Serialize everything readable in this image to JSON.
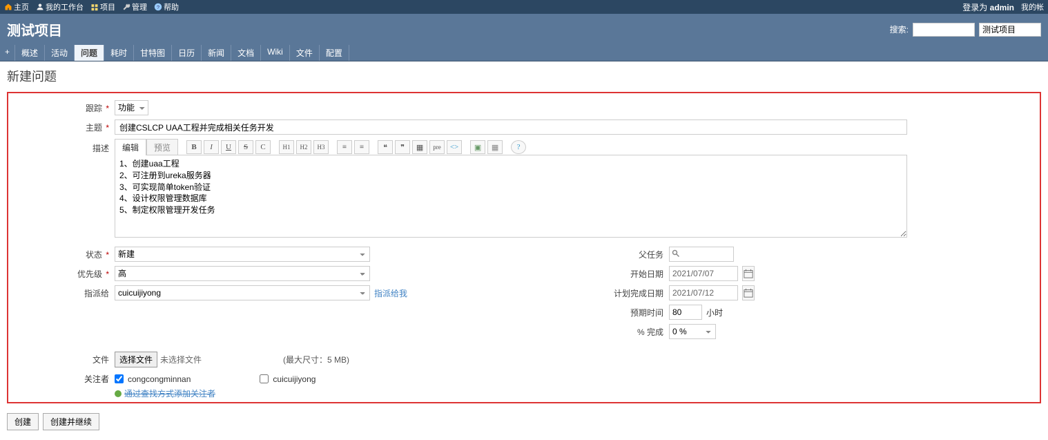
{
  "topnav": {
    "home": "主页",
    "mywork": "我的工作台",
    "projects": "项目",
    "manage": "管理",
    "help": "帮助",
    "logged_in_prefix": "登录为",
    "logged_in_user": "admin",
    "my_account": "我的帐"
  },
  "project": {
    "title": "测试项目",
    "search_label": "搜索:",
    "search_value": "",
    "project_select": "测试项目"
  },
  "tabs": {
    "plus": "+",
    "overview": "概述",
    "activity": "活动",
    "issues": "问题",
    "time": "耗时",
    "gantt": "甘特图",
    "calendar": "日历",
    "news": "新闻",
    "docs": "文档",
    "wiki": "Wiki",
    "files": "文件",
    "settings": "配置"
  },
  "page_title": "新建问题",
  "form": {
    "tracker_label": "跟踪",
    "tracker_value": "功能",
    "subject_label": "主题",
    "subject_value": "创建CSLCP UAA工程并完成相关任务开发",
    "desc_label": "描述",
    "editor": {
      "tab_edit": "编辑",
      "tab_preview": "预览",
      "btn_bold": "B",
      "btn_italic": "I",
      "btn_under": "U",
      "btn_strike": "S",
      "btn_code": "C",
      "btn_h1": "H1",
      "btn_h2": "H2",
      "btn_h3": "H3",
      "btn_ul": "≡",
      "btn_ol": "≡",
      "btn_quote1": "❝",
      "btn_quote2": "❞",
      "btn_table": "▦",
      "btn_pre": "pre",
      "btn_tag": "<>",
      "btn_img": "▣",
      "btn_attach": "▦",
      "btn_help": "?"
    },
    "desc_value": "1、创建uaa工程\n2、可注册到ureka服务器\n3、可实现简单token验证\n4、设计权限管理数据库\n5、制定权限管理开发任务",
    "status_label": "状态",
    "status_value": "新建",
    "priority_label": "优先级",
    "priority_value": "高",
    "assignee_label": "指派给",
    "assignee_value": "cuicuijiyong",
    "assign_me": "指派给我",
    "parent_label": "父任务",
    "parent_value": "",
    "start_label": "开始日期",
    "start_value": "2021/07/07",
    "due_label": "计划完成日期",
    "due_value": "2021/07/12",
    "est_label": "预期时间",
    "est_value": "80",
    "est_unit": "小时",
    "pct_label": "% 完成",
    "pct_value": "0 %",
    "files_label": "文件",
    "file_btn": "选择文件",
    "file_none": "未选择文件",
    "file_hint": "(最大尺寸：5 MB)",
    "watchers_label": "关注者",
    "watcher1": "congcongminnan",
    "watcher2": "cuicuijiyong",
    "search_add": "通过查找方式添加关注者"
  },
  "buttons": {
    "create": "创建",
    "create_continue": "创建并继续"
  }
}
